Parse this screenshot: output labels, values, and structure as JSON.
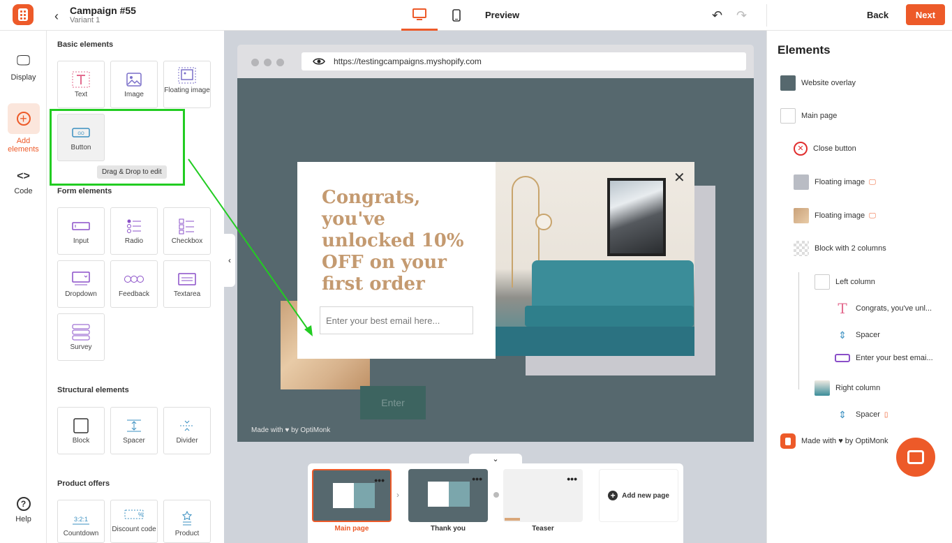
{
  "header": {
    "campaign_title": "Campaign #55",
    "variant": "Variant 1",
    "preview_label": "Preview",
    "back_label": "Back",
    "next_label": "Next"
  },
  "rail": {
    "display": "Display",
    "add_elements": "Add elements",
    "code": "Code",
    "help": "Help"
  },
  "panel": {
    "basic_title": "Basic elements",
    "basic": [
      "Text",
      "Image",
      "Floating image",
      "Button"
    ],
    "tooltip": "Drag & Drop to edit",
    "form_title": "Form elements",
    "form": [
      "Input",
      "Radio",
      "Checkbox",
      "Dropdown",
      "Feedback",
      "Textarea",
      "Survey"
    ],
    "structural_title": "Structural elements",
    "structural": [
      "Block",
      "Spacer",
      "Divider"
    ],
    "product_title": "Product offers",
    "product": [
      "Countdown",
      "Discount code",
      "Product"
    ]
  },
  "canvas": {
    "url": "https://testingcampaigns.myshopify.com",
    "headline": "Congrats, you've unlocked 10% OFF on your first order",
    "email_placeholder": "Enter your best email here...",
    "enter_label": "Enter",
    "made_with": "Made with ♥ by OptiMonk"
  },
  "pages": {
    "items": [
      "Main page",
      "Thank you",
      "Teaser"
    ],
    "add_new": "Add new page"
  },
  "elements_panel": {
    "title": "Elements",
    "items": [
      "Website overlay",
      "Main page",
      "Close button",
      "Floating image",
      "Floating image",
      "Block with 2 columns",
      "Left column",
      "Congrats, you've unl...",
      "Spacer",
      "Enter your best emai...",
      "Right column",
      "Spacer",
      "Made with ♥ by OptiMonk"
    ]
  },
  "colors": {
    "accent": "#ed5a29",
    "overlay": "#56686e",
    "headline": "#c49a70",
    "highlight": "#22cc22"
  }
}
